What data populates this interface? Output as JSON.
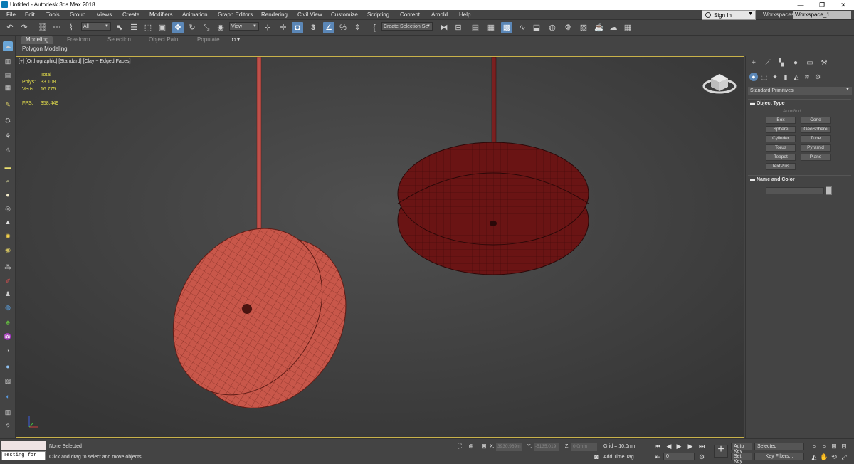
{
  "window": {
    "title": "Untitled - Autodesk 3ds Max 2018",
    "minimize": "—",
    "restore": "❐",
    "close": "✕"
  },
  "menus": [
    "File",
    "Edit",
    "Tools",
    "Group",
    "Views",
    "Create",
    "Modifiers",
    "Animation",
    "Graph Editors",
    "Rendering",
    "Civil View",
    "Customize",
    "Scripting",
    "Content",
    "Arnold",
    "Help"
  ],
  "account": {
    "sign_in": "Sign In",
    "workspaces_label": "Workspaces:",
    "workspace": "Workspace_1"
  },
  "toolbar": {
    "selection_filter": "All",
    "ref_coord": "View",
    "selection_set": "Create Selection Se",
    "snap_label": "3",
    "angle_snap": "%"
  },
  "ribbon": {
    "tabs": [
      "Modeling",
      "Freeform",
      "Selection",
      "Object Paint",
      "Populate"
    ],
    "active": "Modeling",
    "panel": "Polygon Modeling"
  },
  "viewport": {
    "label": "[+] [Orthographic] [Standard] [Clay + Edged Faces]",
    "stats": {
      "header": "Total",
      "polys_label": "Polys:",
      "polys": "33 108",
      "verts_label": "Verts:",
      "verts": "16 775",
      "fps_label": "FPS:",
      "fps": "358,449"
    }
  },
  "command_panel": {
    "category": "Standard Primitives",
    "object_type_title": "Object Type",
    "autogrid": "AutoGrid",
    "object_types": [
      "Box",
      "Cone",
      "Sphere",
      "GeoSphere",
      "Cylinder",
      "Tube",
      "Torus",
      "Pyramid",
      "Teapot",
      "Plane",
      "TextPlus"
    ],
    "name_color_title": "Name and Color"
  },
  "status": {
    "maxscript": "Testing for :",
    "selection": "None Selected",
    "prompt": "Click and drag to select and move objects",
    "x_label": "X:",
    "x": "3930,969m",
    "y_label": "Y:",
    "y": "-5135,019",
    "z_label": "Z:",
    "z": "0,0mm",
    "grid": "Grid = 10,0mm",
    "add_time_tag": "Add Time Tag",
    "auto_key": "Auto Key",
    "set_key": "Set Key",
    "key_mode": "Selected",
    "key_filters": "Key Filters...",
    "frame": "0"
  },
  "colors": {
    "selection_highlight": "#5b87b7",
    "viewport_border": "#c9b24a",
    "stats_text": "#e8e24c",
    "yoyo_1": "#c8574a",
    "yoyo_2": "#6a1414"
  }
}
